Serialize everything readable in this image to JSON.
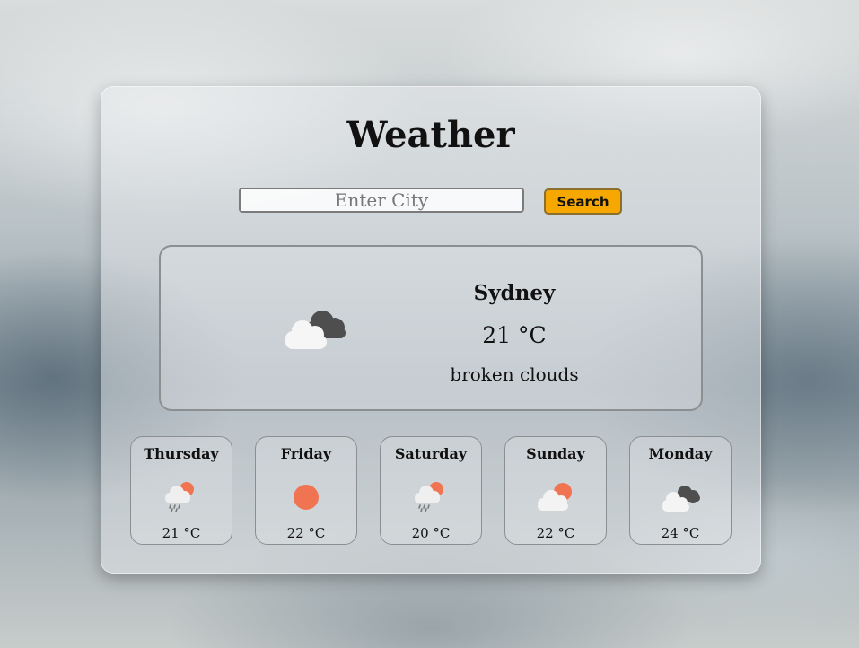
{
  "app": {
    "title": "Weather"
  },
  "search": {
    "placeholder": "Enter City",
    "value": "",
    "button_label": "Search"
  },
  "current": {
    "city": "Sydney",
    "temperature": "21 °C",
    "description": "broken clouds",
    "icon": "broken-clouds-icon"
  },
  "forecast": [
    {
      "day": "Thursday",
      "temperature": "21 °C",
      "icon": "rain-sun-icon"
    },
    {
      "day": "Friday",
      "temperature": "22 °C",
      "icon": "sun-icon"
    },
    {
      "day": "Saturday",
      "temperature": "20 °C",
      "icon": "rain-sun-icon"
    },
    {
      "day": "Sunday",
      "temperature": "22 °C",
      "icon": "sun-cloud-icon"
    },
    {
      "day": "Monday",
      "temperature": "24 °C",
      "icon": "broken-clouds-icon"
    }
  ],
  "colors": {
    "accent": "#f7a800",
    "sun": "#f07352",
    "cloud_light": "#f4f4f4",
    "cloud_dark": "#505050"
  }
}
